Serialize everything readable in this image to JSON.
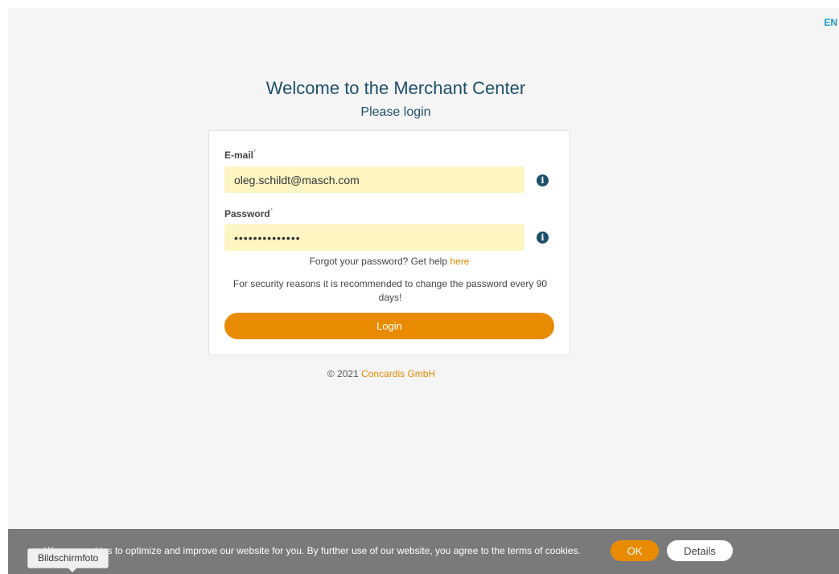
{
  "header": {
    "language": "EN",
    "title": "Welcome to the Merchant Center",
    "subtitle": "Please login"
  },
  "form": {
    "email_label": "E-mail",
    "email_value": "oleg.schildt@masch.com",
    "password_label": "Password",
    "password_value": "••••••••••••••",
    "required_mark": "*",
    "info_icon": "info-icon",
    "forgot_text": "Forgot your password? Get help",
    "forgot_link": "here",
    "security_note": "For security reasons it is recommended to change the password every 90 days!",
    "login_label": "Login"
  },
  "footer": {
    "copyright": "© 2021",
    "company": "Concardis GmbH"
  },
  "cookie_bar": {
    "text": "We use cookies to optimize and improve our website for you. By further use of our website, you agree to the terms of cookies.",
    "ok_label": "OK",
    "details_label": "Details"
  },
  "tooltip": {
    "text": "Bildschirmfoto"
  },
  "colors": {
    "accent": "#e98b00",
    "heading": "#1d4f6b",
    "input_bg": "#fdf5c2",
    "cookie_bg": "#7a7a7a",
    "lang_link": "#1a9ac8"
  }
}
